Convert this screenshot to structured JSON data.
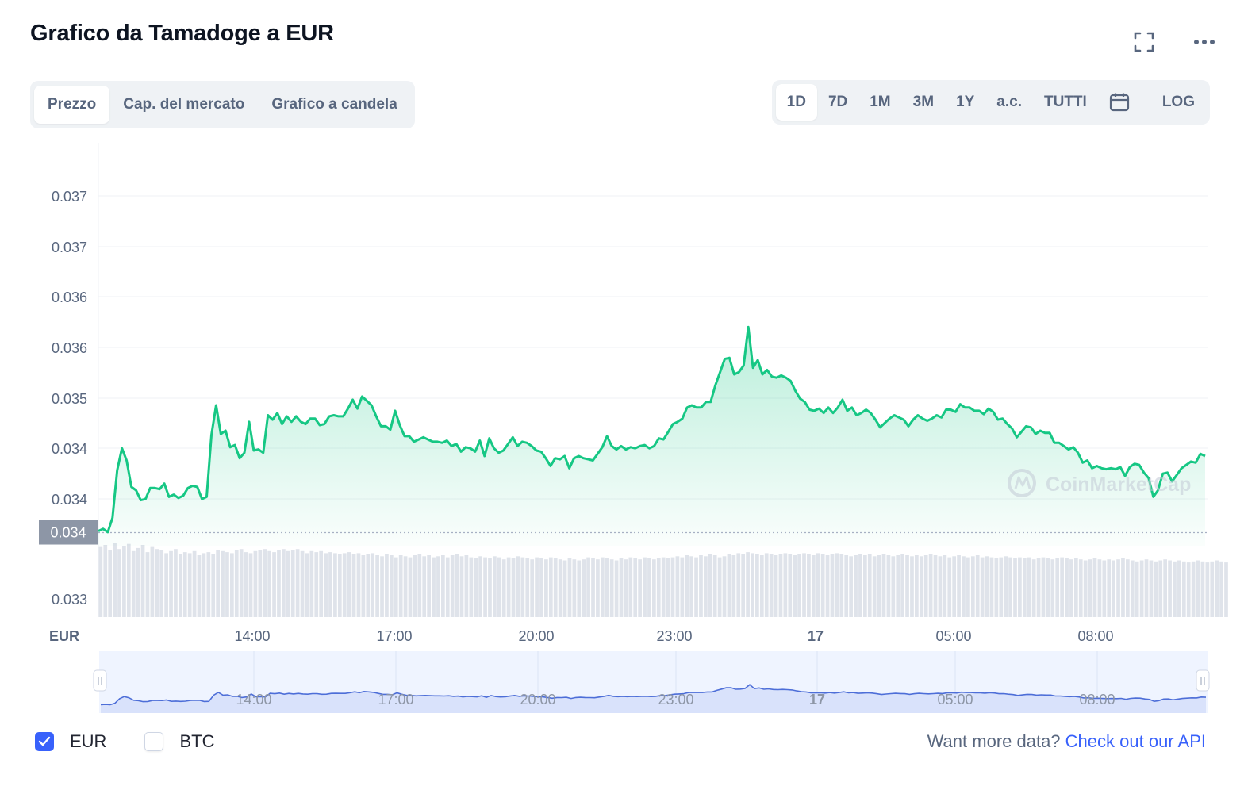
{
  "title": "Grafico da Tamadoge a EUR",
  "icons": {
    "fullscreen": "fullscreen-icon",
    "more": "more-dots-icon",
    "calendar": "calendar-icon",
    "check": "check-icon",
    "logo": "coinmarketcap-logo-icon"
  },
  "tabs": [
    {
      "label": "Prezzo",
      "active": true
    },
    {
      "label": "Cap. del mercato",
      "active": false
    },
    {
      "label": "Grafico a candela",
      "active": false
    }
  ],
  "ranges": [
    {
      "label": "1D",
      "active": true
    },
    {
      "label": "7D",
      "active": false
    },
    {
      "label": "1M",
      "active": false
    },
    {
      "label": "3M",
      "active": false
    },
    {
      "label": "1Y",
      "active": false
    },
    {
      "label": "a.c.",
      "active": false
    },
    {
      "label": "TUTTI",
      "active": false
    }
  ],
  "log_label": "LOG",
  "currency_label": "EUR",
  "current_price_label": "0.034",
  "watermark": "CoinMarketCap",
  "colors": {
    "line": "#16c784",
    "accent": "#3861fb",
    "navigator_line": "#4d6ed8"
  },
  "chart_data": {
    "type": "line",
    "y_tick_labels": [
      "0.037",
      "0.037",
      "0.036",
      "0.036",
      "0.035",
      "0.034",
      "0.034",
      "0.033"
    ],
    "x_tick_labels": [
      "14:00",
      "17:00",
      "20:00",
      "23:00",
      "17",
      "05:00",
      "08:00"
    ],
    "ylim": [
      0.0331,
      0.0374
    ],
    "series": [
      {
        "values": [
          0.03388,
          0.0339,
          0.03387,
          0.034,
          0.03443,
          0.03463,
          0.03452,
          0.03428,
          0.03425,
          0.03416,
          0.03417,
          0.03427,
          0.03427,
          0.03426,
          0.03431,
          0.03419,
          0.03421,
          0.03418,
          0.0342,
          0.03427,
          0.03429,
          0.03428,
          0.03417,
          0.03419,
          0.03475,
          0.03502,
          0.03476,
          0.03479,
          0.03464,
          0.03466,
          0.03454,
          0.03459,
          0.03487,
          0.03461,
          0.03462,
          0.03459,
          0.03493,
          0.03489,
          0.03495,
          0.03485,
          0.03492,
          0.03487,
          0.03492,
          0.03487,
          0.03485,
          0.0349,
          0.0349,
          0.03484,
          0.03485,
          0.03492,
          0.03493,
          0.03492,
          0.03492,
          0.03499,
          0.03507,
          0.03499,
          0.0351,
          0.03506,
          0.03502,
          0.03492,
          0.03483,
          0.03483,
          0.0348,
          0.03497,
          0.03484,
          0.03474,
          0.03474,
          0.03469,
          0.03471,
          0.03473,
          0.03471,
          0.03469,
          0.03469,
          0.03468,
          0.0347,
          0.03465,
          0.03467,
          0.0346,
          0.03464,
          0.03463,
          0.0346,
          0.0347,
          0.03456,
          0.03472,
          0.03463,
          0.03459,
          0.03461,
          0.03467,
          0.03473,
          0.03465,
          0.03469,
          0.03468,
          0.03465,
          0.03461,
          0.0346,
          0.03454,
          0.03447,
          0.03454,
          0.03453,
          0.03456,
          0.03445,
          0.03454,
          0.03456,
          0.03454,
          0.03453,
          0.03452,
          0.03458,
          0.03464,
          0.03474,
          0.03465,
          0.03462,
          0.03465,
          0.03462,
          0.03464,
          0.03463,
          0.03465,
          0.03466,
          0.03463,
          0.03465,
          0.03472,
          0.03471,
          0.03478,
          0.03485,
          0.03487,
          0.0349,
          0.035,
          0.03502,
          0.035,
          0.035,
          0.03505,
          0.03505,
          0.0352,
          0.03532,
          0.03544,
          0.03545,
          0.0353,
          0.03532,
          0.03538,
          0.03573,
          0.03536,
          0.03543,
          0.0353,
          0.03534,
          0.03528,
          0.03527,
          0.03529,
          0.03527,
          0.03524,
          0.03515,
          0.03508,
          0.03505,
          0.03498,
          0.03497,
          0.03499,
          0.03495,
          0.035,
          0.03495,
          0.035,
          0.03507,
          0.03497,
          0.035,
          0.03493,
          0.03495,
          0.03498,
          0.03495,
          0.03489,
          0.03482,
          0.03486,
          0.0349,
          0.03493,
          0.03491,
          0.03489,
          0.03483,
          0.03489,
          0.03493,
          0.0349,
          0.03488,
          0.0349,
          0.03493,
          0.03491,
          0.03498,
          0.03498,
          0.03496,
          0.03503,
          0.035,
          0.035,
          0.03497,
          0.03497,
          0.03494,
          0.03499,
          0.03496,
          0.03489,
          0.0349,
          0.03485,
          0.03481,
          0.03473,
          0.03478,
          0.03483,
          0.03482,
          0.03476,
          0.03479,
          0.03477,
          0.03477,
          0.03468,
          0.03468,
          0.03465,
          0.03462,
          0.03464,
          0.03459,
          0.0345,
          0.03452,
          0.03445,
          0.03447,
          0.03445,
          0.03444,
          0.03445,
          0.03444,
          0.03446,
          0.03438,
          0.03446,
          0.03449,
          0.03448,
          0.03441,
          0.03436,
          0.03419,
          0.03425,
          0.0344,
          0.03441,
          0.03433,
          0.03439,
          0.03445,
          0.03448,
          0.03451,
          0.0345,
          0.03458,
          0.03456
        ],
        "volumes": [
          68,
          70,
          65,
          72,
          66,
          69,
          71,
          64,
          67,
          70,
          63,
          68,
          66,
          65,
          62,
          64,
          66,
          61,
          63,
          62,
          64,
          60,
          62,
          63,
          61,
          65,
          64,
          63,
          62,
          65,
          66,
          63,
          62,
          64,
          65,
          66,
          64,
          63,
          65,
          66,
          64,
          65,
          66,
          64,
          62,
          64,
          63,
          64,
          62,
          63,
          62,
          61,
          62,
          63,
          61,
          62,
          60,
          61,
          62,
          60,
          59,
          61,
          60,
          58,
          60,
          59,
          58,
          60,
          61,
          59,
          60,
          58,
          59,
          60,
          58,
          60,
          61,
          59,
          60,
          58,
          57,
          59,
          58,
          57,
          59,
          58,
          56,
          58,
          57,
          59,
          58,
          57,
          56,
          58,
          57,
          56,
          58,
          57,
          56,
          55,
          57,
          56,
          55,
          56,
          58,
          57,
          56,
          58,
          57,
          56,
          55,
          57,
          56,
          58,
          57,
          56,
          58,
          57,
          56,
          57,
          58,
          57,
          58,
          59,
          58,
          60,
          59,
          58,
          60,
          59,
          61,
          60,
          58,
          59,
          61,
          60,
          62,
          61,
          63,
          62,
          61,
          60,
          62,
          61,
          60,
          61,
          62,
          61,
          60,
          61,
          62,
          61,
          60,
          62,
          61,
          60,
          61,
          62,
          61,
          60,
          59,
          60,
          61,
          60,
          61,
          59,
          60,
          61,
          60,
          59,
          60,
          61,
          60,
          59,
          60,
          59,
          60,
          61,
          60,
          59,
          60,
          58,
          59,
          60,
          59,
          58,
          59,
          60,
          58,
          59,
          58,
          57,
          58,
          59,
          58,
          57,
          58,
          57,
          58,
          56,
          57,
          58,
          57,
          56,
          57,
          58,
          57,
          56,
          57,
          56,
          55,
          56,
          57,
          56,
          55,
          56,
          55,
          56,
          57,
          56,
          55,
          54,
          55,
          56,
          55,
          54,
          55,
          56,
          55,
          54,
          55,
          54,
          53,
          54,
          55,
          54,
          53,
          54,
          55,
          54,
          53
        ]
      }
    ]
  }
}
